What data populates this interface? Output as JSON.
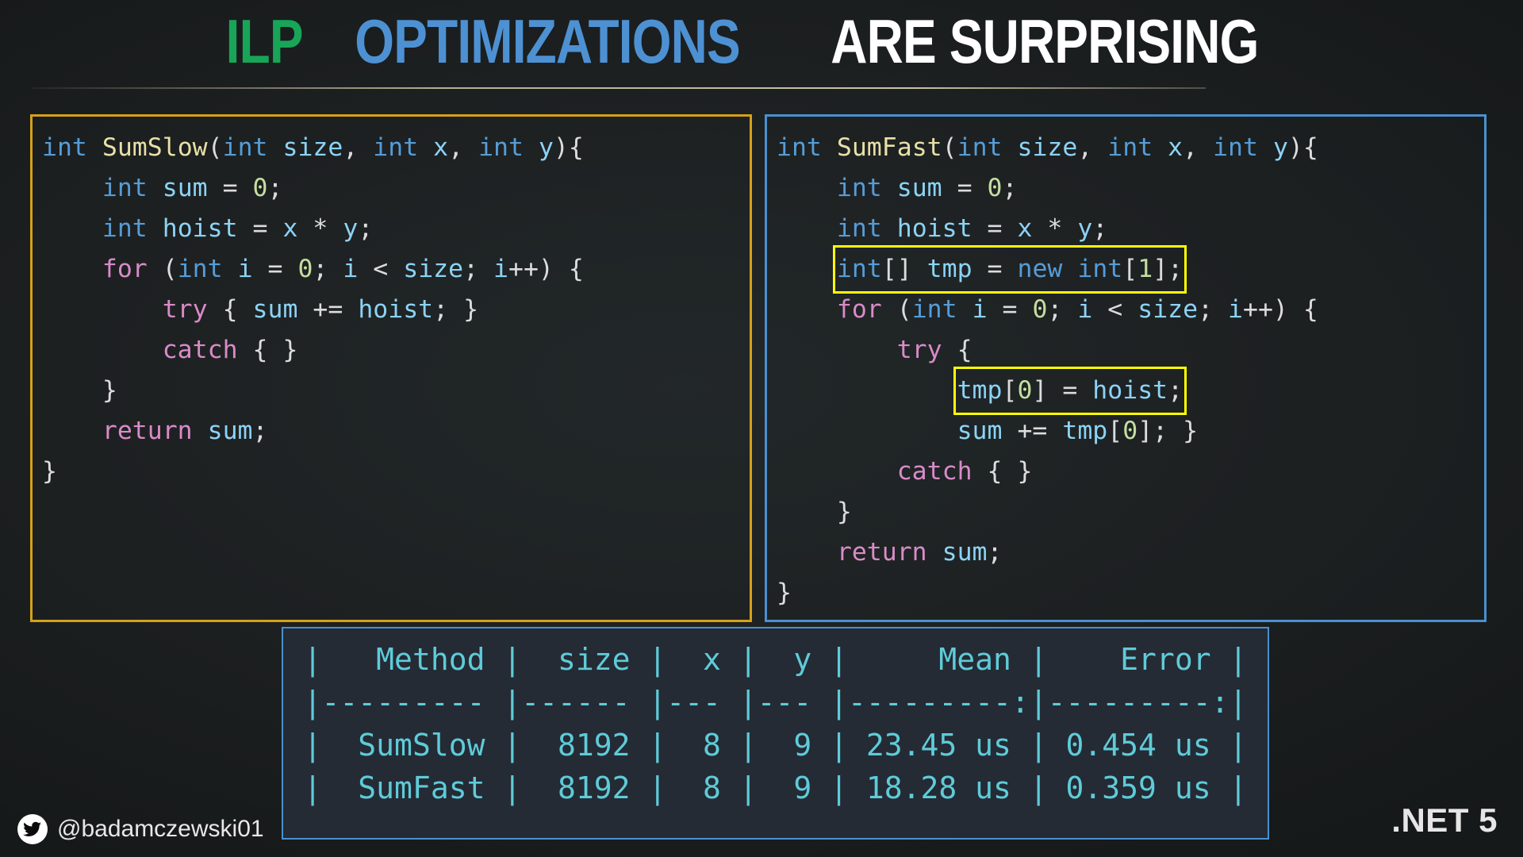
{
  "title": {
    "part_ilp": "ILP",
    "part_optimizations": "OPTIMIZATIONS",
    "part_rest": "ARE SURPRISING",
    "color_ilp": "#18A558",
    "color_optimizations": "#4D91D3",
    "color_rest": "#FFFFFF"
  },
  "code_left": {
    "border_color": "#D6A01A",
    "lines": [
      "int SumSlow(int size, int x, int y){",
      "    int sum = 0;",
      "    int hoist = x * y;",
      "    for (int i = 0; i < size; i++) {",
      "        try { sum += hoist; }",
      "        catch { }",
      "    }",
      "    return sum;",
      "}"
    ]
  },
  "code_right": {
    "border_color": "#4A90D0",
    "highlight_color": "#FFFF00",
    "highlighted_snippets": [
      "int[] tmp = new int[1];",
      "tmp[0] = hoist;"
    ],
    "lines": [
      "int SumFast(int size, int x, int y){",
      "    int sum = 0;",
      "    int hoist = x * y;",
      "    int[] tmp = new int[1];",
      "    for (int i = 0; i < size; i++) {",
      "        try {",
      "            tmp[0] = hoist;",
      "            sum += tmp[0]; }",
      "        catch { }",
      "    }",
      "    return sum;",
      "}"
    ]
  },
  "benchmark": {
    "text_color": "#5FCBD8",
    "border_color": "#4A90D0",
    "columns": [
      "Method",
      "size",
      "x",
      "y",
      "Mean",
      "Error"
    ],
    "header_line": "|   Method |  size |  x |  y |     Mean |    Error |",
    "separator_line": "|--------- |------ |--- |--- |---------:|---------:|",
    "rows": [
      {
        "method": "SumSlow",
        "size": "8192",
        "x": "8",
        "y": "9",
        "mean": "23.45 us",
        "error": "0.454 us",
        "line": "|  SumSlow |  8192 |  8 |  9 | 23.45 us | 0.454 us |"
      },
      {
        "method": "SumFast",
        "size": "8192",
        "x": "8",
        "y": "9",
        "mean": "18.28 us",
        "error": "0.359 us",
        "line": "|  SumFast |  8192 |  8 |  9 | 18.28 us | 0.359 us |"
      }
    ]
  },
  "footer": {
    "twitter_handle": "@badamczewski01",
    "platform_badge": ".NET 5"
  }
}
